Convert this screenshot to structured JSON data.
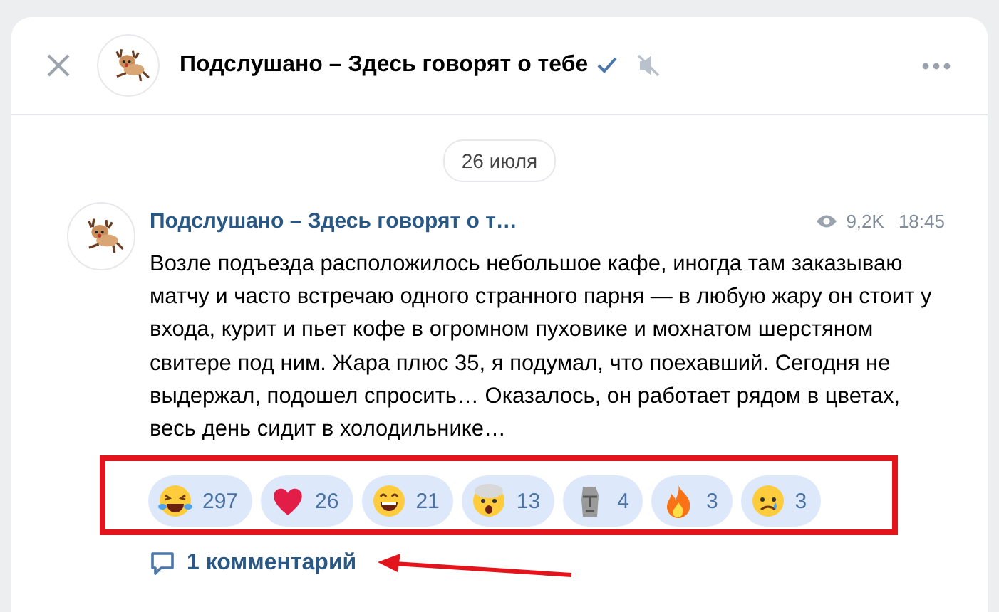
{
  "header": {
    "title": "Подслушано – Здесь говорят о тебе",
    "verified": true,
    "muted": true
  },
  "date_separator": "26 июля",
  "post": {
    "author": "Подслушано – Здесь говорят о т…",
    "views": "9,2K",
    "time": "18:45",
    "text": "Возле подъезда расположилось небольшое кафе, иногда там заказываю матчу и часто встречаю одного странного парня — в любую жару он стоит у входа, курит и пьет кофе в огромном пуховике и мохнатом шерстяном свитере под ним. Жара плюс 35, я подумал, что поехавший. Сегодня не выдержал, подошел спросить… Оказалось, он работает рядом в цветах, весь день сидит в холодильнике…",
    "reactions": [
      {
        "kind": "laughing",
        "count": "297"
      },
      {
        "kind": "heart",
        "count": "26"
      },
      {
        "kind": "smile",
        "count": "21"
      },
      {
        "kind": "shocked",
        "count": "13"
      },
      {
        "kind": "statue",
        "count": "4"
      },
      {
        "kind": "fire",
        "count": "3"
      },
      {
        "kind": "crying",
        "count": "3"
      }
    ],
    "comments": "1 комментарий"
  }
}
